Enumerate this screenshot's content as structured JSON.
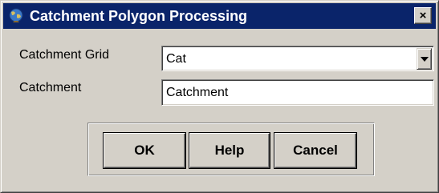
{
  "window": {
    "title": "Catchment Polygon Processing",
    "close_label": "×"
  },
  "form": {
    "catchment_grid": {
      "label": "Catchment Grid",
      "value": "Cat"
    },
    "catchment": {
      "label": "Catchment",
      "value": "Catchment"
    }
  },
  "buttons": {
    "ok": "OK",
    "help": "Help",
    "cancel": "Cancel"
  },
  "colors": {
    "titlebar": "#0a246a",
    "face": "#d4d0c8"
  },
  "icons": {
    "app": "globe-icon",
    "close": "close-icon",
    "dropdown": "chevron-down-icon"
  }
}
